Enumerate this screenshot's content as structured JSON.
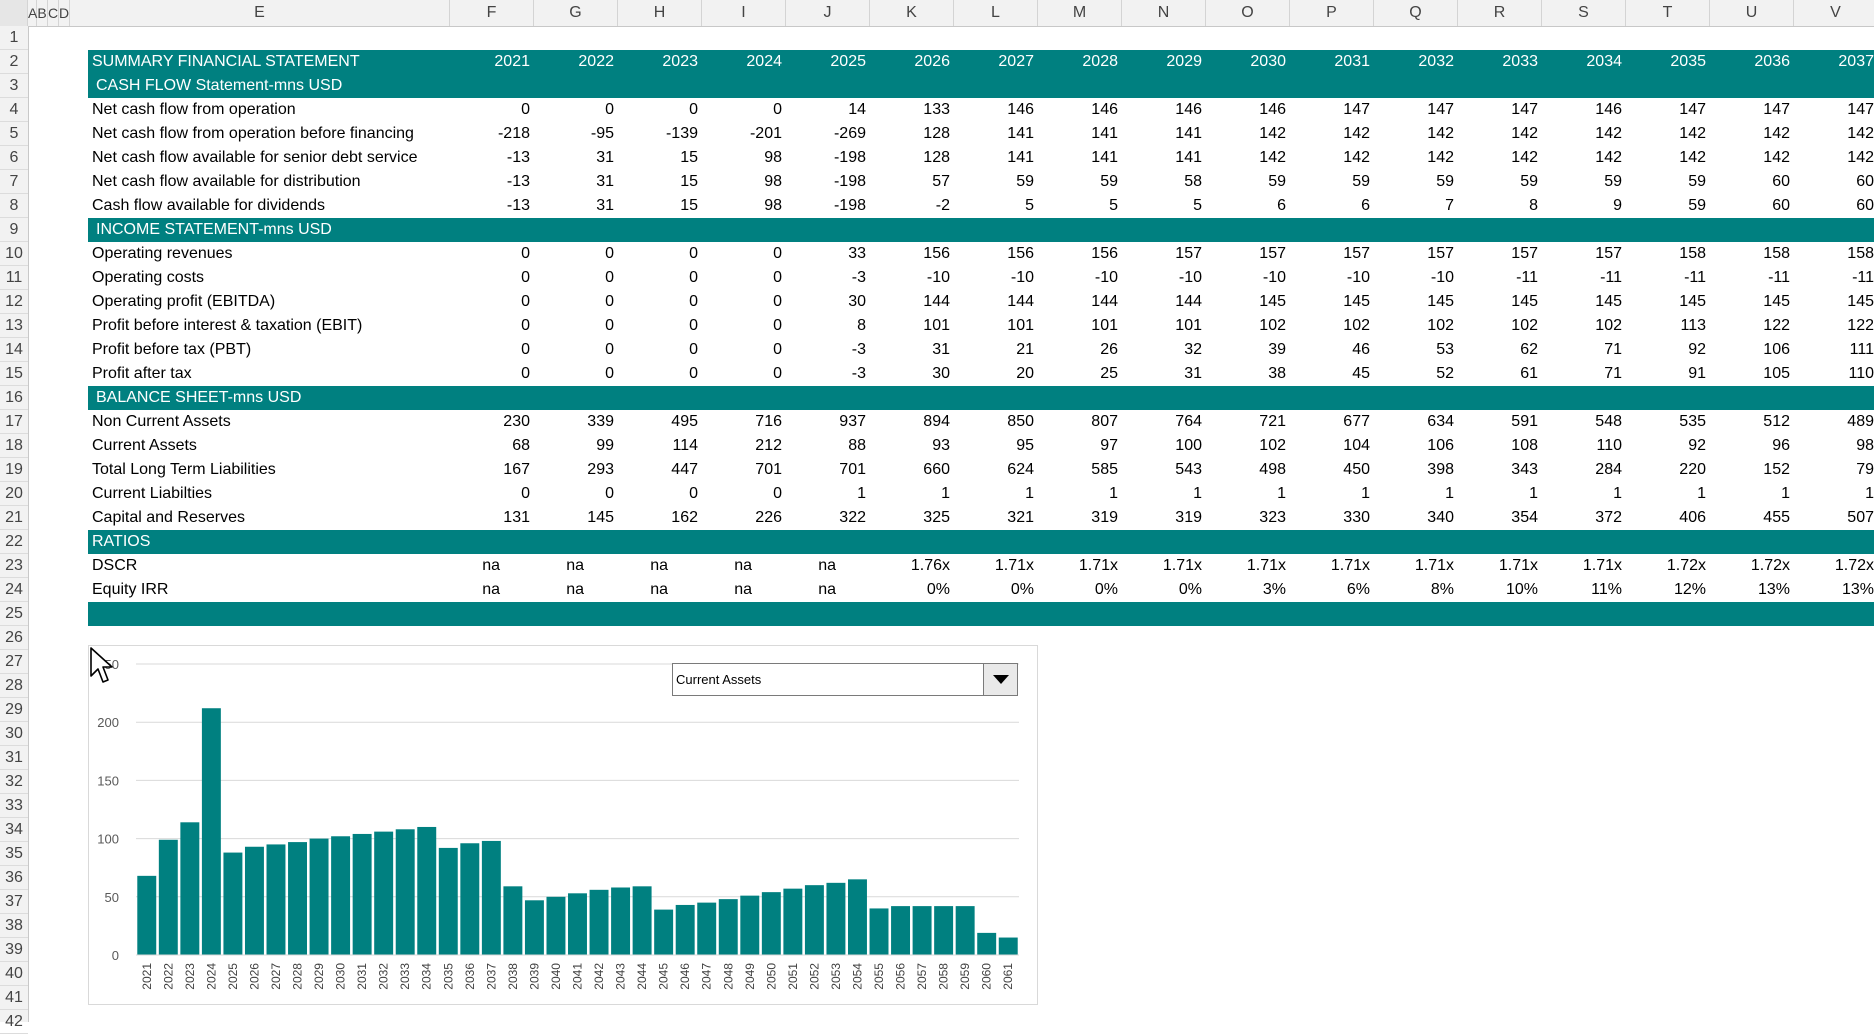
{
  "columns": [
    "A",
    "B",
    "C",
    "D",
    "E",
    "F",
    "G",
    "H",
    "I",
    "J",
    "K",
    "L",
    "M",
    "N",
    "O",
    "P",
    "Q",
    "R",
    "S",
    "T",
    "U",
    "V"
  ],
  "row_numbers": [
    "1",
    "2",
    "3",
    "4",
    "5",
    "6",
    "7",
    "8",
    "9",
    "10",
    "11",
    "12",
    "13",
    "14",
    "15",
    "16",
    "17",
    "18",
    "19",
    "20",
    "21",
    "22",
    "23",
    "24",
    "25",
    "26",
    "27",
    "28",
    "29",
    "30",
    "31",
    "32",
    "33",
    "34",
    "35",
    "36",
    "37",
    "38",
    "39",
    "40",
    "41",
    "42"
  ],
  "header": {
    "title": "SUMMARY FINANCIAL STATEMENT",
    "years": [
      "2021",
      "2022",
      "2023",
      "2024",
      "2025",
      "2026",
      "2027",
      "2028",
      "2029",
      "2030",
      "2031",
      "2032",
      "2033",
      "2034",
      "2035",
      "2036",
      "2037"
    ]
  },
  "sections": [
    {
      "title": "CASH FLOW Statement-mns USD",
      "rows": [
        {
          "label": "Net cash flow from operation",
          "values": [
            "0",
            "0",
            "0",
            "0",
            "14",
            "133",
            "146",
            "146",
            "146",
            "146",
            "147",
            "147",
            "147",
            "146",
            "147",
            "147",
            "147"
          ]
        },
        {
          "label": "Net cash flow from operation before financing",
          "values": [
            "-218",
            "-95",
            "-139",
            "-201",
            "-269",
            "128",
            "141",
            "141",
            "141",
            "142",
            "142",
            "142",
            "142",
            "142",
            "142",
            "142",
            "142"
          ]
        },
        {
          "label": "Net cash flow available for senior debt service",
          "values": [
            "-13",
            "31",
            "15",
            "98",
            "-198",
            "128",
            "141",
            "141",
            "141",
            "142",
            "142",
            "142",
            "142",
            "142",
            "142",
            "142",
            "142"
          ]
        },
        {
          "label": "Net cash flow available for distribution",
          "values": [
            "-13",
            "31",
            "15",
            "98",
            "-198",
            "57",
            "59",
            "59",
            "58",
            "59",
            "59",
            "59",
            "59",
            "59",
            "59",
            "60",
            "60"
          ]
        },
        {
          "label": "Cash flow available for dividends",
          "values": [
            "-13",
            "31",
            "15",
            "98",
            "-198",
            "-2",
            "5",
            "5",
            "5",
            "6",
            "6",
            "7",
            "8",
            "9",
            "59",
            "60",
            "60"
          ]
        }
      ]
    },
    {
      "title": "INCOME STATEMENT-mns USD",
      "rows": [
        {
          "label": "Operating revenues",
          "values": [
            "0",
            "0",
            "0",
            "0",
            "33",
            "156",
            "156",
            "156",
            "157",
            "157",
            "157",
            "157",
            "157",
            "157",
            "158",
            "158",
            "158"
          ]
        },
        {
          "label": "Operating costs",
          "values": [
            "0",
            "0",
            "0",
            "0",
            "-3",
            "-10",
            "-10",
            "-10",
            "-10",
            "-10",
            "-10",
            "-10",
            "-11",
            "-11",
            "-11",
            "-11",
            "-11"
          ]
        },
        {
          "label": "Operating profit (EBITDA)",
          "values": [
            "0",
            "0",
            "0",
            "0",
            "30",
            "144",
            "144",
            "144",
            "144",
            "145",
            "145",
            "145",
            "145",
            "145",
            "145",
            "145",
            "145"
          ]
        },
        {
          "label": "Profit before interest & taxation (EBIT)",
          "values": [
            "0",
            "0",
            "0",
            "0",
            "8",
            "101",
            "101",
            "101",
            "101",
            "102",
            "102",
            "102",
            "102",
            "102",
            "113",
            "122",
            "122"
          ]
        },
        {
          "label": "Profit before tax (PBT)",
          "values": [
            "0",
            "0",
            "0",
            "0",
            "-3",
            "31",
            "21",
            "26",
            "32",
            "39",
            "46",
            "53",
            "62",
            "71",
            "92",
            "106",
            "111"
          ]
        },
        {
          "label": "Profit after tax",
          "values": [
            "0",
            "0",
            "0",
            "0",
            "-3",
            "30",
            "20",
            "25",
            "31",
            "38",
            "45",
            "52",
            "61",
            "71",
            "91",
            "105",
            "110"
          ]
        }
      ]
    },
    {
      "title": "BALANCE SHEET-mns USD",
      "rows": [
        {
          "label": "Non Current Assets",
          "values": [
            "230",
            "339",
            "495",
            "716",
            "937",
            "894",
            "850",
            "807",
            "764",
            "721",
            "677",
            "634",
            "591",
            "548",
            "535",
            "512",
            "489"
          ]
        },
        {
          "label": "Current Assets",
          "values": [
            "68",
            "99",
            "114",
            "212",
            "88",
            "93",
            "95",
            "97",
            "100",
            "102",
            "104",
            "106",
            "108",
            "110",
            "92",
            "96",
            "98"
          ]
        },
        {
          "label": "Total Long Term Liabilities",
          "values": [
            "167",
            "293",
            "447",
            "701",
            "701",
            "660",
            "624",
            "585",
            "543",
            "498",
            "450",
            "398",
            "343",
            "284",
            "220",
            "152",
            "79"
          ]
        },
        {
          "label": "Current Liabilties",
          "values": [
            "0",
            "0",
            "0",
            "0",
            "1",
            "1",
            "1",
            "1",
            "1",
            "1",
            "1",
            "1",
            "1",
            "1",
            "1",
            "1",
            "1"
          ]
        },
        {
          "label": "Capital and Reserves",
          "values": [
            "131",
            "145",
            "162",
            "226",
            "322",
            "325",
            "321",
            "319",
            "319",
            "323",
            "330",
            "340",
            "354",
            "372",
            "406",
            "455",
            "507"
          ]
        }
      ]
    },
    {
      "title": "RATIOS",
      "rows": [
        {
          "label": "DSCR",
          "values": [
            "na",
            "na",
            "na",
            "na",
            "na",
            "1.76x",
            "1.71x",
            "1.71x",
            "1.71x",
            "1.71x",
            "1.71x",
            "1.71x",
            "1.71x",
            "1.71x",
            "1.72x",
            "1.72x",
            "1.72x"
          ]
        },
        {
          "label": "Equity IRR",
          "values": [
            "na",
            "na",
            "na",
            "na",
            "na",
            "0%",
            "0%",
            "0%",
            "0%",
            "3%",
            "6%",
            "8%",
            "10%",
            "11%",
            "12%",
            "13%",
            "13%"
          ]
        }
      ]
    }
  ],
  "dropdown": {
    "selected": "Current Assets"
  },
  "colors": {
    "band": "#008080",
    "bar": "#008080",
    "header_bg": "#f2f2f2"
  },
  "chart_data": {
    "type": "bar",
    "title": "",
    "ylim": [
      0,
      250
    ],
    "yticks": [
      0,
      50,
      100,
      150,
      200,
      250
    ],
    "grid": true,
    "categories": [
      "2021",
      "2022",
      "2023",
      "2024",
      "2025",
      "2026",
      "2027",
      "2028",
      "2029",
      "2030",
      "2031",
      "2032",
      "2033",
      "2034",
      "2035",
      "2036",
      "2037",
      "2038",
      "2039",
      "2040",
      "2041",
      "2042",
      "2043",
      "2044",
      "2045",
      "2046",
      "2047",
      "2048",
      "2049",
      "2050",
      "2051",
      "2052",
      "2053",
      "2054",
      "2055",
      "2056",
      "2057",
      "2058",
      "2059",
      "2060",
      "2061"
    ],
    "values": [
      68,
      99,
      114,
      212,
      88,
      93,
      95,
      97,
      100,
      102,
      104,
      106,
      108,
      110,
      92,
      96,
      98,
      59,
      47,
      50,
      53,
      56,
      58,
      59,
      39,
      43,
      45,
      48,
      51,
      54,
      57,
      60,
      62,
      65,
      40,
      42,
      42,
      42,
      42,
      19,
      15
    ]
  }
}
